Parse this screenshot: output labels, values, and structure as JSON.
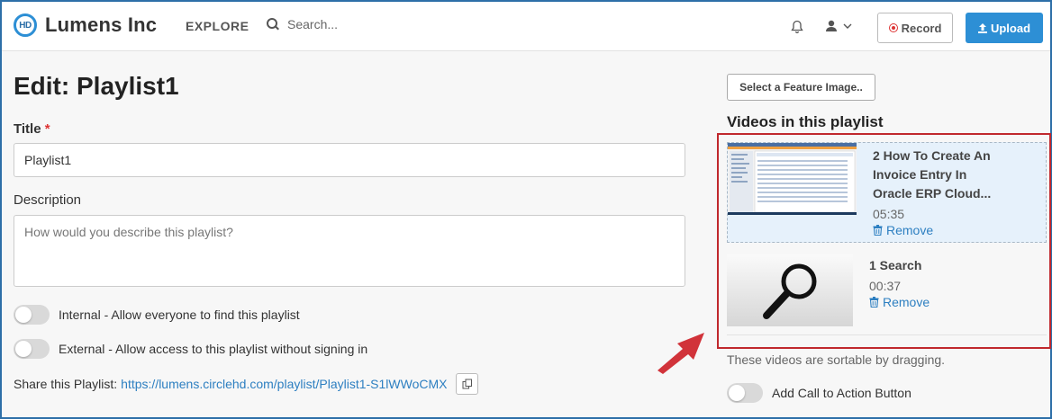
{
  "header": {
    "logo_mark": "HD",
    "app_name": "Lumens Inc",
    "nav_explore": "EXPLORE",
    "search_placeholder": "Search...",
    "record_label": "Record",
    "upload_label": "Upload"
  },
  "form": {
    "page_title": "Edit: Playlist1",
    "title_label": "Title",
    "title_required": "*",
    "title_value": "Playlist1",
    "description_label": "Description",
    "description_placeholder": "How would you describe this playlist?",
    "internal_toggle_label": "Internal - Allow everyone to find this playlist",
    "internal_toggle_on": false,
    "external_toggle_label": "External - Allow access to this playlist without signing in",
    "external_toggle_on": false,
    "share_label": "Share this Playlist:",
    "share_url": "https://lumens.circlehd.com/playlist/Playlist1-S1lWWoCMX"
  },
  "sidebar": {
    "feature_image_button": "Select a Feature Image..",
    "videos_heading": "Videos in this playlist",
    "videos": [
      {
        "title": "2 How To Create An Invoice Entry In Oracle ERP Cloud...",
        "duration": "05:35",
        "remove_label": "Remove",
        "thumbnail": "oracle-erp-screenshot"
      },
      {
        "title": "1 Search",
        "duration": "00:37",
        "remove_label": "Remove",
        "thumbnail": "magnifier-icon"
      }
    ],
    "sortable_note": "These videos are sortable by dragging.",
    "cta_toggle_label": "Add Call to Action Button",
    "cta_toggle_on": false
  },
  "colors": {
    "accent": "#2d8fd5",
    "link": "#2d7fc1",
    "highlight_border": "#c0282d",
    "annotation_arrow": "#d1333a",
    "required": "#dd3333"
  }
}
